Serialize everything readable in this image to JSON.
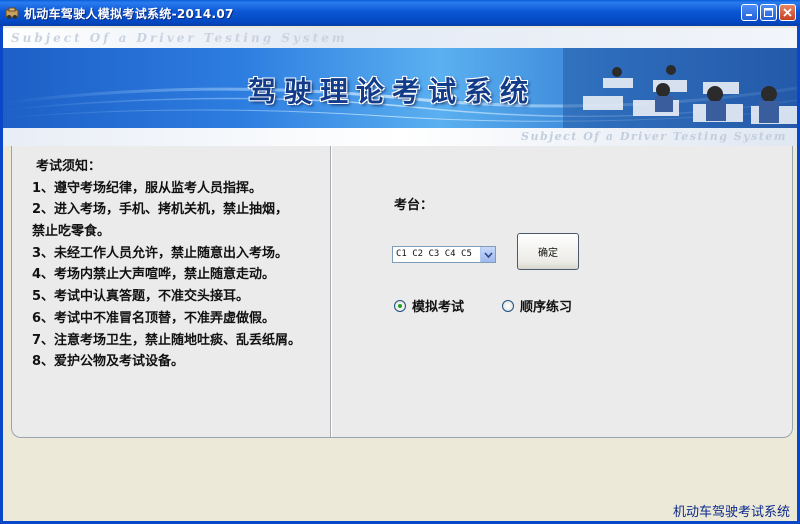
{
  "window": {
    "title": "机动车驾驶人模拟考试系统-2014.07"
  },
  "banner": {
    "subtitle_top": "Subject Of a Driver Testing System",
    "main_title": "驾驶理论考试系统",
    "subtitle_bottom": "Subject Of a Driver Testing System"
  },
  "notice": {
    "title": "考试须知：",
    "items": [
      "1、遵守考场纪律，服从监考人员指挥。",
      "2、进入考场，手机、拷机关机，禁止抽烟，",
      "禁止吃零食。",
      "3、未经工作人员允许，禁止随意出入考场。",
      "4、考场内禁止大声喧哗，禁止随意走动。",
      "5、考试中认真答题，不准交头接耳。",
      "6、考试中不准冒名顶替，不准弄虚做假。",
      "7、注意考场卫生，禁止随地吐痰、乱丢纸屑。",
      "8、爱护公物及考试设备。"
    ]
  },
  "form": {
    "station_label": "考台：",
    "station_selected": "C1 C2 C3 C4 C5",
    "confirm_label": "确定",
    "mode_simulate": "模拟考试",
    "mode_practice": "顺序练习"
  },
  "footer": {
    "text": "机动车驾驶考试系统"
  },
  "colors": {
    "titlebar": "#0b56d4",
    "banner_blue": "#2d7de0",
    "panel_bg": "#ecebeb",
    "radio_dot": "#21a121"
  }
}
